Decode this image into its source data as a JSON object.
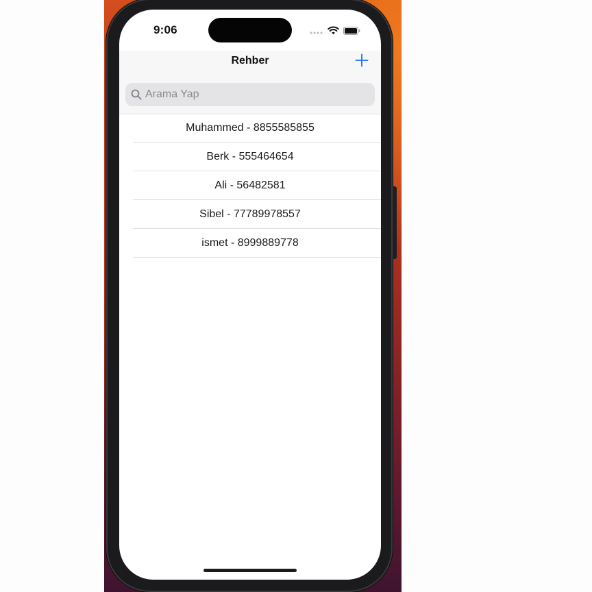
{
  "status_bar": {
    "time": "9:06",
    "icons": [
      "signal-dots-icon",
      "wifi-icon",
      "battery-icon"
    ]
  },
  "nav": {
    "title": "Rehber",
    "add_icon": "plus-icon",
    "accent_color": "#2f7cf6"
  },
  "search": {
    "placeholder": "Arama Yap",
    "value": "",
    "icon": "search-icon"
  },
  "contacts": [
    {
      "label": "Muhammed - 8855585855"
    },
    {
      "label": "Berk - 555464654"
    },
    {
      "label": "Ali - 56482581"
    },
    {
      "label": "Sibel - 77789978557"
    },
    {
      "label": "ismet - 8999889778"
    }
  ]
}
